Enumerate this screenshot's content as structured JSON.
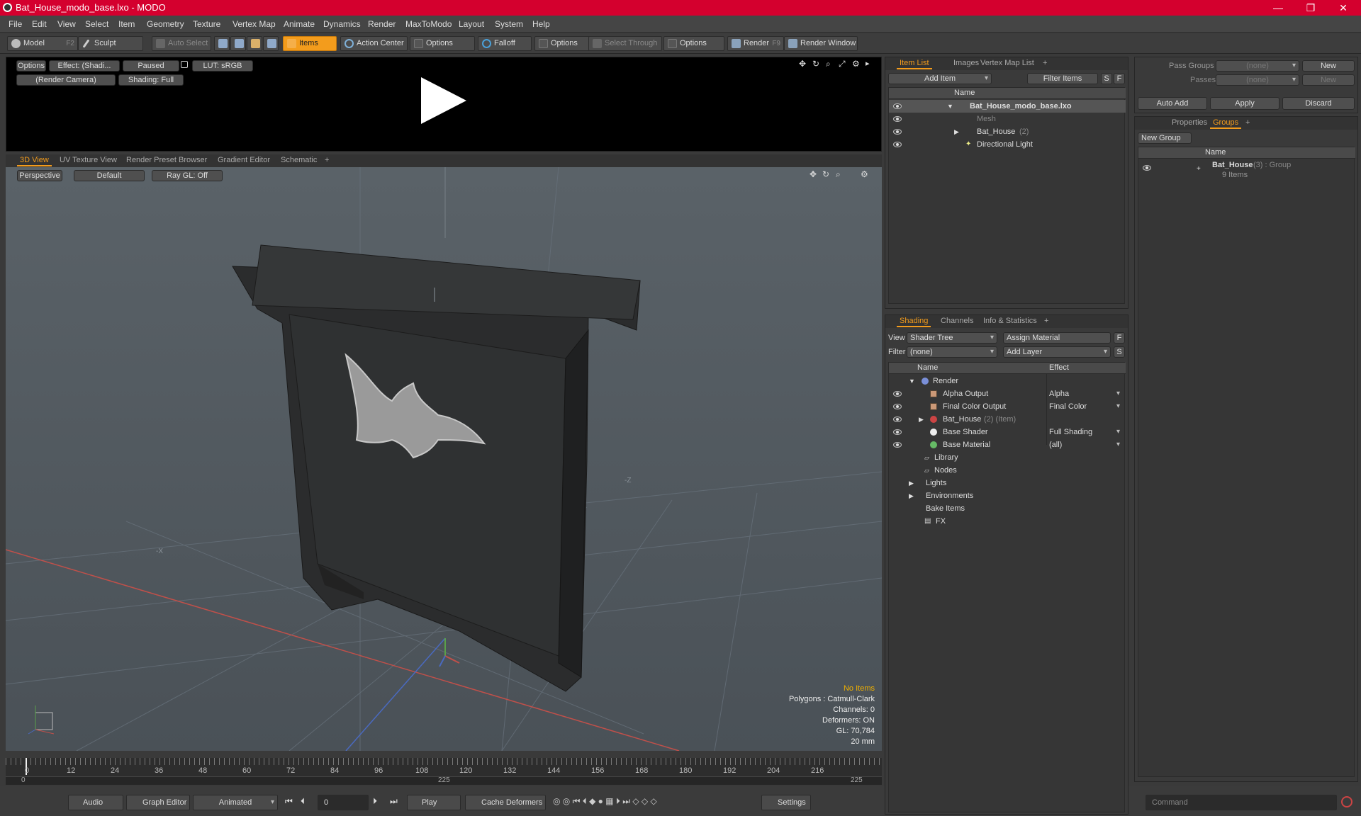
{
  "window": {
    "title": "Bat_House_modo_base.lxo - MODO"
  },
  "menu": [
    "File",
    "Edit",
    "View",
    "Select",
    "Item",
    "Geometry",
    "Texture",
    "Vertex Map",
    "Animate",
    "Dynamics",
    "Render",
    "MaxToModo",
    "Layout",
    "System",
    "Help"
  ],
  "toolbar": {
    "model": "Model",
    "model_key": "F2",
    "sculpt": "Sculpt",
    "auto_select": "Auto Select",
    "items": "Items",
    "action_center": "Action Center",
    "options1": "Options",
    "falloff": "Falloff",
    "options2": "Options",
    "select_through": "Select Through",
    "options3": "Options",
    "render": "Render",
    "render_key": "F9",
    "render_window": "Render Window"
  },
  "preview": {
    "options": "Options",
    "effect": "Effect: (Shadi...",
    "paused": "Paused",
    "lut": "LUT: sRGB",
    "camera": "(Render Camera)",
    "shading": "Shading: Full"
  },
  "viewport_tabs": [
    "3D View",
    "UV Texture View",
    "Render Preset Browser",
    "Gradient Editor",
    "Schematic",
    "+"
  ],
  "viewport": {
    "perspective": "Perspective",
    "default": "Default",
    "raygl": "Ray GL: Off",
    "axis_x": "-X",
    "axis_z": "-Z",
    "hud": {
      "no_items": "No Items",
      "polygons": "Polygons : Catmull-Clark",
      "channels": "Channels: 0",
      "deformers": "Deformers: ON",
      "gl": "GL: 70,784",
      "scale": "20 mm"
    }
  },
  "timeline": {
    "ticks": [
      "0",
      "12",
      "24",
      "36",
      "48",
      "60",
      "72",
      "84",
      "96",
      "108",
      "120",
      "132",
      "144",
      "156",
      "168",
      "180",
      "192",
      "204",
      "216"
    ],
    "start": "0",
    "mid": "225",
    "end": "225"
  },
  "bottom": {
    "audio": "Audio",
    "graph_editor": "Graph Editor",
    "animated": "Animated",
    "frame": "0",
    "play": "Play",
    "cache": "Cache Deformers",
    "settings": "Settings"
  },
  "item_list": {
    "tabs": [
      "Item List",
      "Images",
      "Vertex Map List",
      "+"
    ],
    "add_item": "Add Item",
    "filter_items": "Filter Items",
    "s": "S",
    "f": "F",
    "header": "Name",
    "rows": [
      {
        "label": "Bat_House_modo_base.lxo",
        "extra": ""
      },
      {
        "label": "Mesh",
        "extra": ""
      },
      {
        "label": "Bat_House",
        "extra": "(2)"
      },
      {
        "label": "Directional Light",
        "extra": ""
      }
    ]
  },
  "shading": {
    "tabs": [
      "Shading",
      "Channels",
      "Info & Statistics",
      "+"
    ],
    "view_label": "View",
    "view_value": "Shader Tree",
    "assign_material": "Assign Material",
    "filter_label": "Filter",
    "filter_value": "(none)",
    "add_layer": "Add Layer",
    "f": "F",
    "s": "S",
    "col_name": "Name",
    "col_effect": "Effect",
    "rows": [
      {
        "label": "Render",
        "extra": "",
        "effect": ""
      },
      {
        "label": "Alpha Output",
        "extra": "",
        "effect": "Alpha"
      },
      {
        "label": "Final Color Output",
        "extra": "",
        "effect": "Final Color"
      },
      {
        "label": "Bat_House",
        "extra": "(2) (Item)",
        "effect": ""
      },
      {
        "label": "Base Shader",
        "extra": "",
        "effect": "Full Shading"
      },
      {
        "label": "Base Material",
        "extra": "",
        "effect": "(all)"
      },
      {
        "label": "Library",
        "extra": "",
        "effect": ""
      },
      {
        "label": "Nodes",
        "extra": "",
        "effect": ""
      },
      {
        "label": "Lights",
        "extra": "",
        "effect": ""
      },
      {
        "label": "Environments",
        "extra": "",
        "effect": ""
      },
      {
        "label": "Bake Items",
        "extra": "",
        "effect": ""
      },
      {
        "label": "FX",
        "extra": "",
        "effect": ""
      }
    ]
  },
  "right": {
    "pass_groups": "Pass Groups",
    "pass_groups_value": "(none)",
    "new": "New",
    "passes": "Passes",
    "passes_value": "(none)",
    "new2": "New",
    "auto_add": "Auto Add",
    "apply": "Apply",
    "discard": "Discard",
    "tabs": [
      "Properties",
      "Groups",
      "+"
    ],
    "new_group": "New Group",
    "col_name": "Name",
    "group_name": "Bat_House",
    "group_extra": "(3) : Group",
    "group_items": "9 Items",
    "command_placeholder": "Command"
  }
}
